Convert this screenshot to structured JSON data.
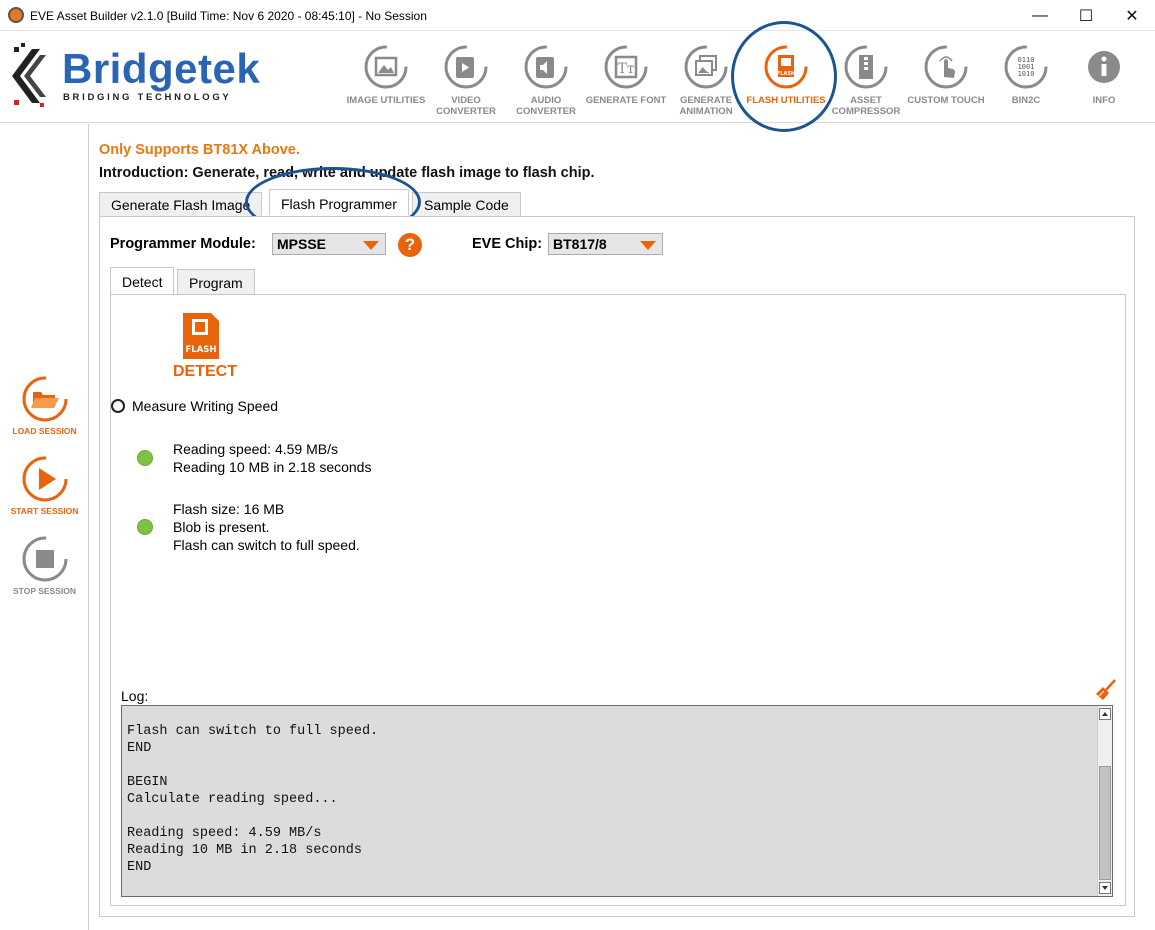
{
  "window": {
    "title": "EVE Asset Builder v2.1.0 [Build Time: Nov  6 2020 - 08:45:10] - No Session",
    "minimize": "—",
    "maximize": "☐",
    "close": "✕"
  },
  "brand": {
    "name": "Bridgetek",
    "tagline": "BRIDGING   TECHNOLOGY",
    "color": "#2a64b4"
  },
  "toolbar": {
    "items": [
      {
        "label": "IMAGE UTILITIES",
        "icon": "image-icon"
      },
      {
        "label": "VIDEO CONVERTER",
        "icon": "video-icon"
      },
      {
        "label": "AUDIO CONVERTER",
        "icon": "audio-icon"
      },
      {
        "label": "GENERATE FONT",
        "icon": "font-icon"
      },
      {
        "label": "GENERATE ANIMATION",
        "icon": "animation-icon"
      },
      {
        "label": "FLASH UTILITIES",
        "icon": "flash-icon",
        "active": true
      },
      {
        "label": "ASSET COMPRESSOR",
        "icon": "compressor-icon"
      },
      {
        "label": "CUSTOM TOUCH",
        "icon": "touch-icon"
      },
      {
        "label": "BIN2C",
        "icon": "binary-icon"
      },
      {
        "label": "INFO",
        "icon": "info-icon"
      }
    ],
    "accent": "#e8630a"
  },
  "sidebar": {
    "load": "LOAD SESSION",
    "start": "START SESSION",
    "stop": "STOP SESSION"
  },
  "main": {
    "support_note": "Only Supports BT81X Above.",
    "intro": "Introduction: Generate, read, write and update flash image to flash chip.",
    "tabs": [
      "Generate Flash Image",
      "Flash Programmer",
      "Sample Code"
    ],
    "programmer_module_label": "Programmer Module:",
    "programmer_module_value": "MPSSE",
    "help": "?",
    "eve_chip_label": "EVE Chip:",
    "eve_chip_value": "BT817/8",
    "subtabs": [
      "Detect",
      "Program"
    ],
    "detect_flash_text": "FLASH",
    "detect_label": "DETECT",
    "measure_label": "Measure Writing Speed",
    "reading_status": [
      "Reading speed: 4.59 MB/s",
      "Reading 10 MB in 2.18 seconds"
    ],
    "flash_status": [
      "Flash size: 16 MB",
      "Blob is present.",
      "Flash can switch to full speed."
    ],
    "log_label": "Log:",
    "log_text": "Flash can switch to full speed.\nEND\n\nBEGIN\nCalculate reading speed...\n\nReading speed: 4.59 MB/s\nReading 10 MB in 2.18 seconds\nEND"
  }
}
